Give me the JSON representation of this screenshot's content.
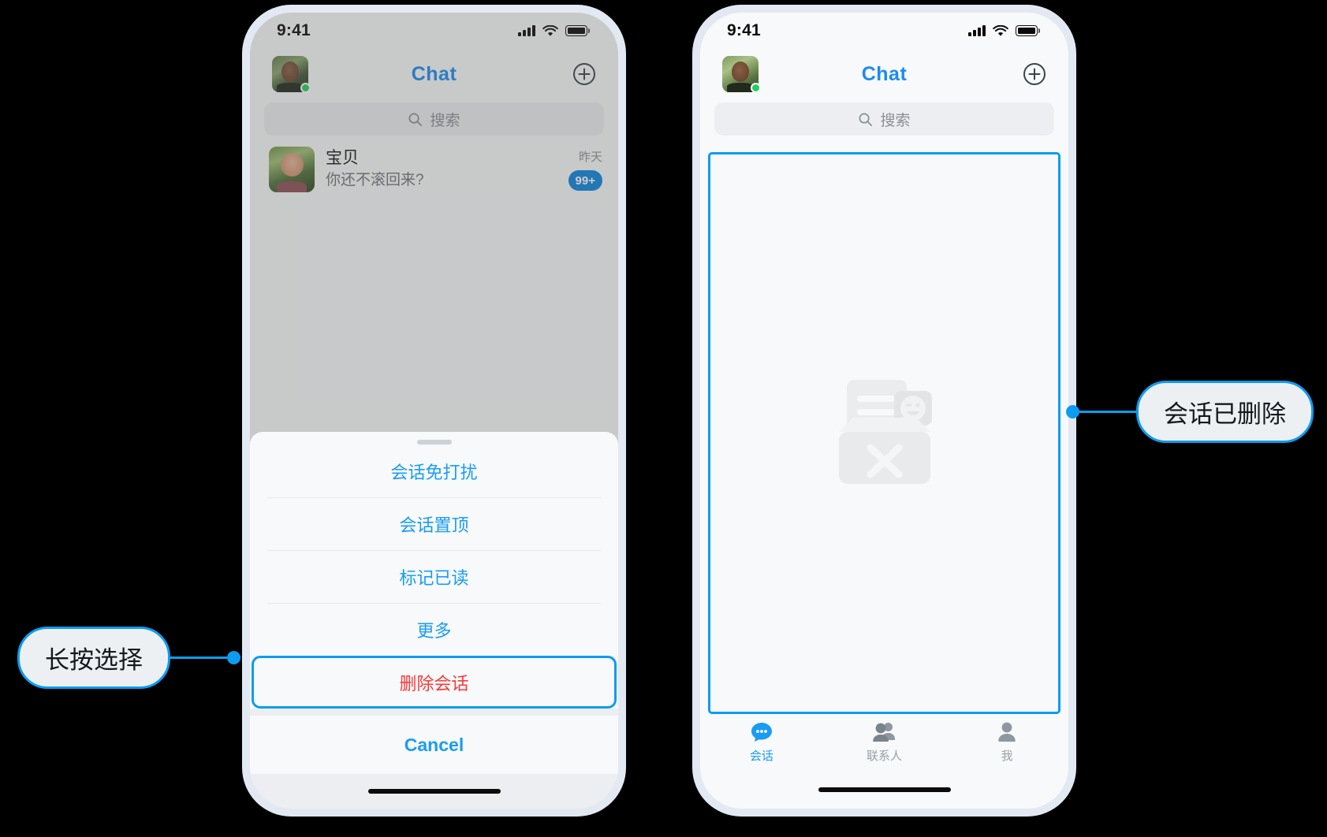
{
  "meta": {
    "accent_blue": "#1a9cf5",
    "danger_red": "#fa3a3a",
    "badge_blue": "#0c84dd",
    "callout_border": "#0c9cf0",
    "online_green": "#21d05c"
  },
  "status_bar": {
    "time": "9:41",
    "icons": [
      "signal-bars-icon",
      "wifi-icon",
      "battery-icon"
    ]
  },
  "header": {
    "title": "Chat",
    "avatar_name": "user-avatar",
    "add_button": "add-circle-icon"
  },
  "search": {
    "placeholder": "搜索",
    "icon": "search-icon"
  },
  "chat_list": {
    "rows": [
      {
        "name": "宝贝",
        "preview": "你还不滚回来?",
        "time": "昨天",
        "badge": "99+"
      }
    ]
  },
  "action_sheet": {
    "items": [
      {
        "label": "会话免打扰",
        "style": "normal"
      },
      {
        "label": "会话置顶",
        "style": "normal"
      },
      {
        "label": "标记已读",
        "style": "normal"
      },
      {
        "label": "更多",
        "style": "normal"
      },
      {
        "label": "删除会话",
        "style": "danger-highlighted"
      }
    ],
    "cancel": "Cancel"
  },
  "empty_state": {
    "illustration": "empty-inbox-illustration"
  },
  "tab_bar": {
    "tabs": [
      {
        "label": "会话",
        "icon": "chat-bubble-icon",
        "active": true
      },
      {
        "label": "联系人",
        "icon": "contacts-icon",
        "active": false
      },
      {
        "label": "我",
        "icon": "person-icon",
        "active": false
      }
    ]
  },
  "callouts": {
    "left": "长按选择",
    "right": "会话已删除"
  }
}
